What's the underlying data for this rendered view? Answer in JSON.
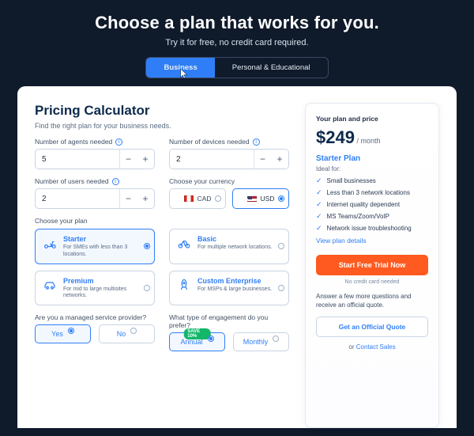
{
  "hero": {
    "title": "Choose a plan that works for you.",
    "subtitle": "Try it for free, no credit card required."
  },
  "tabs": {
    "business": "Business",
    "personal": "Personal & Educational"
  },
  "calculator": {
    "title": "Pricing Calculator",
    "subtitle": "Find the right plan for your business needs.",
    "agents_label": "Number of agents needed",
    "agents_value": "5",
    "devices_label": "Number of devices needed",
    "devices_value": "2",
    "users_label": "Number of users needed",
    "users_value": "2",
    "currency_label": "Choose your currency",
    "currency_cad": "CAD",
    "currency_usd": "USD",
    "plan_label": "Choose your plan",
    "plans": {
      "starter": {
        "name": "Starter",
        "desc": "For SMEs with less than 3 locations."
      },
      "basic": {
        "name": "Basic",
        "desc": "For multiple network locations."
      },
      "premium": {
        "name": "Premium",
        "desc": "For mid to large multisites networks."
      },
      "enterprise": {
        "name": "Custom Enterprise",
        "desc": "For MSPs & large businesses."
      }
    },
    "msp_label": "Are you a managed service provider?",
    "yes": "Yes",
    "no": "No",
    "engagement_label": "What type of engagement do you prefer?",
    "save_badge": "SAVE 10%",
    "annual": "Annual",
    "monthly": "Monthly"
  },
  "summary": {
    "heading": "Your plan and price",
    "price": "$249",
    "per": " / month",
    "plan_name": "Starter Plan",
    "ideal_for": "Ideal for:",
    "features": [
      "Small businesses",
      "Less than 3 network locations",
      "Internet quality dependent",
      "MS Teams/Zoom/VoIP",
      "Network issue troubleshooting"
    ],
    "view_details": "View plan details",
    "cta": "Start Free Trial Now",
    "no_card": "No credit card needed",
    "answer_more": "Answer a few more questions and receive an official quote.",
    "quote_btn": "Get an Official Quote",
    "or": "or ",
    "contact": "Contact Sales"
  }
}
